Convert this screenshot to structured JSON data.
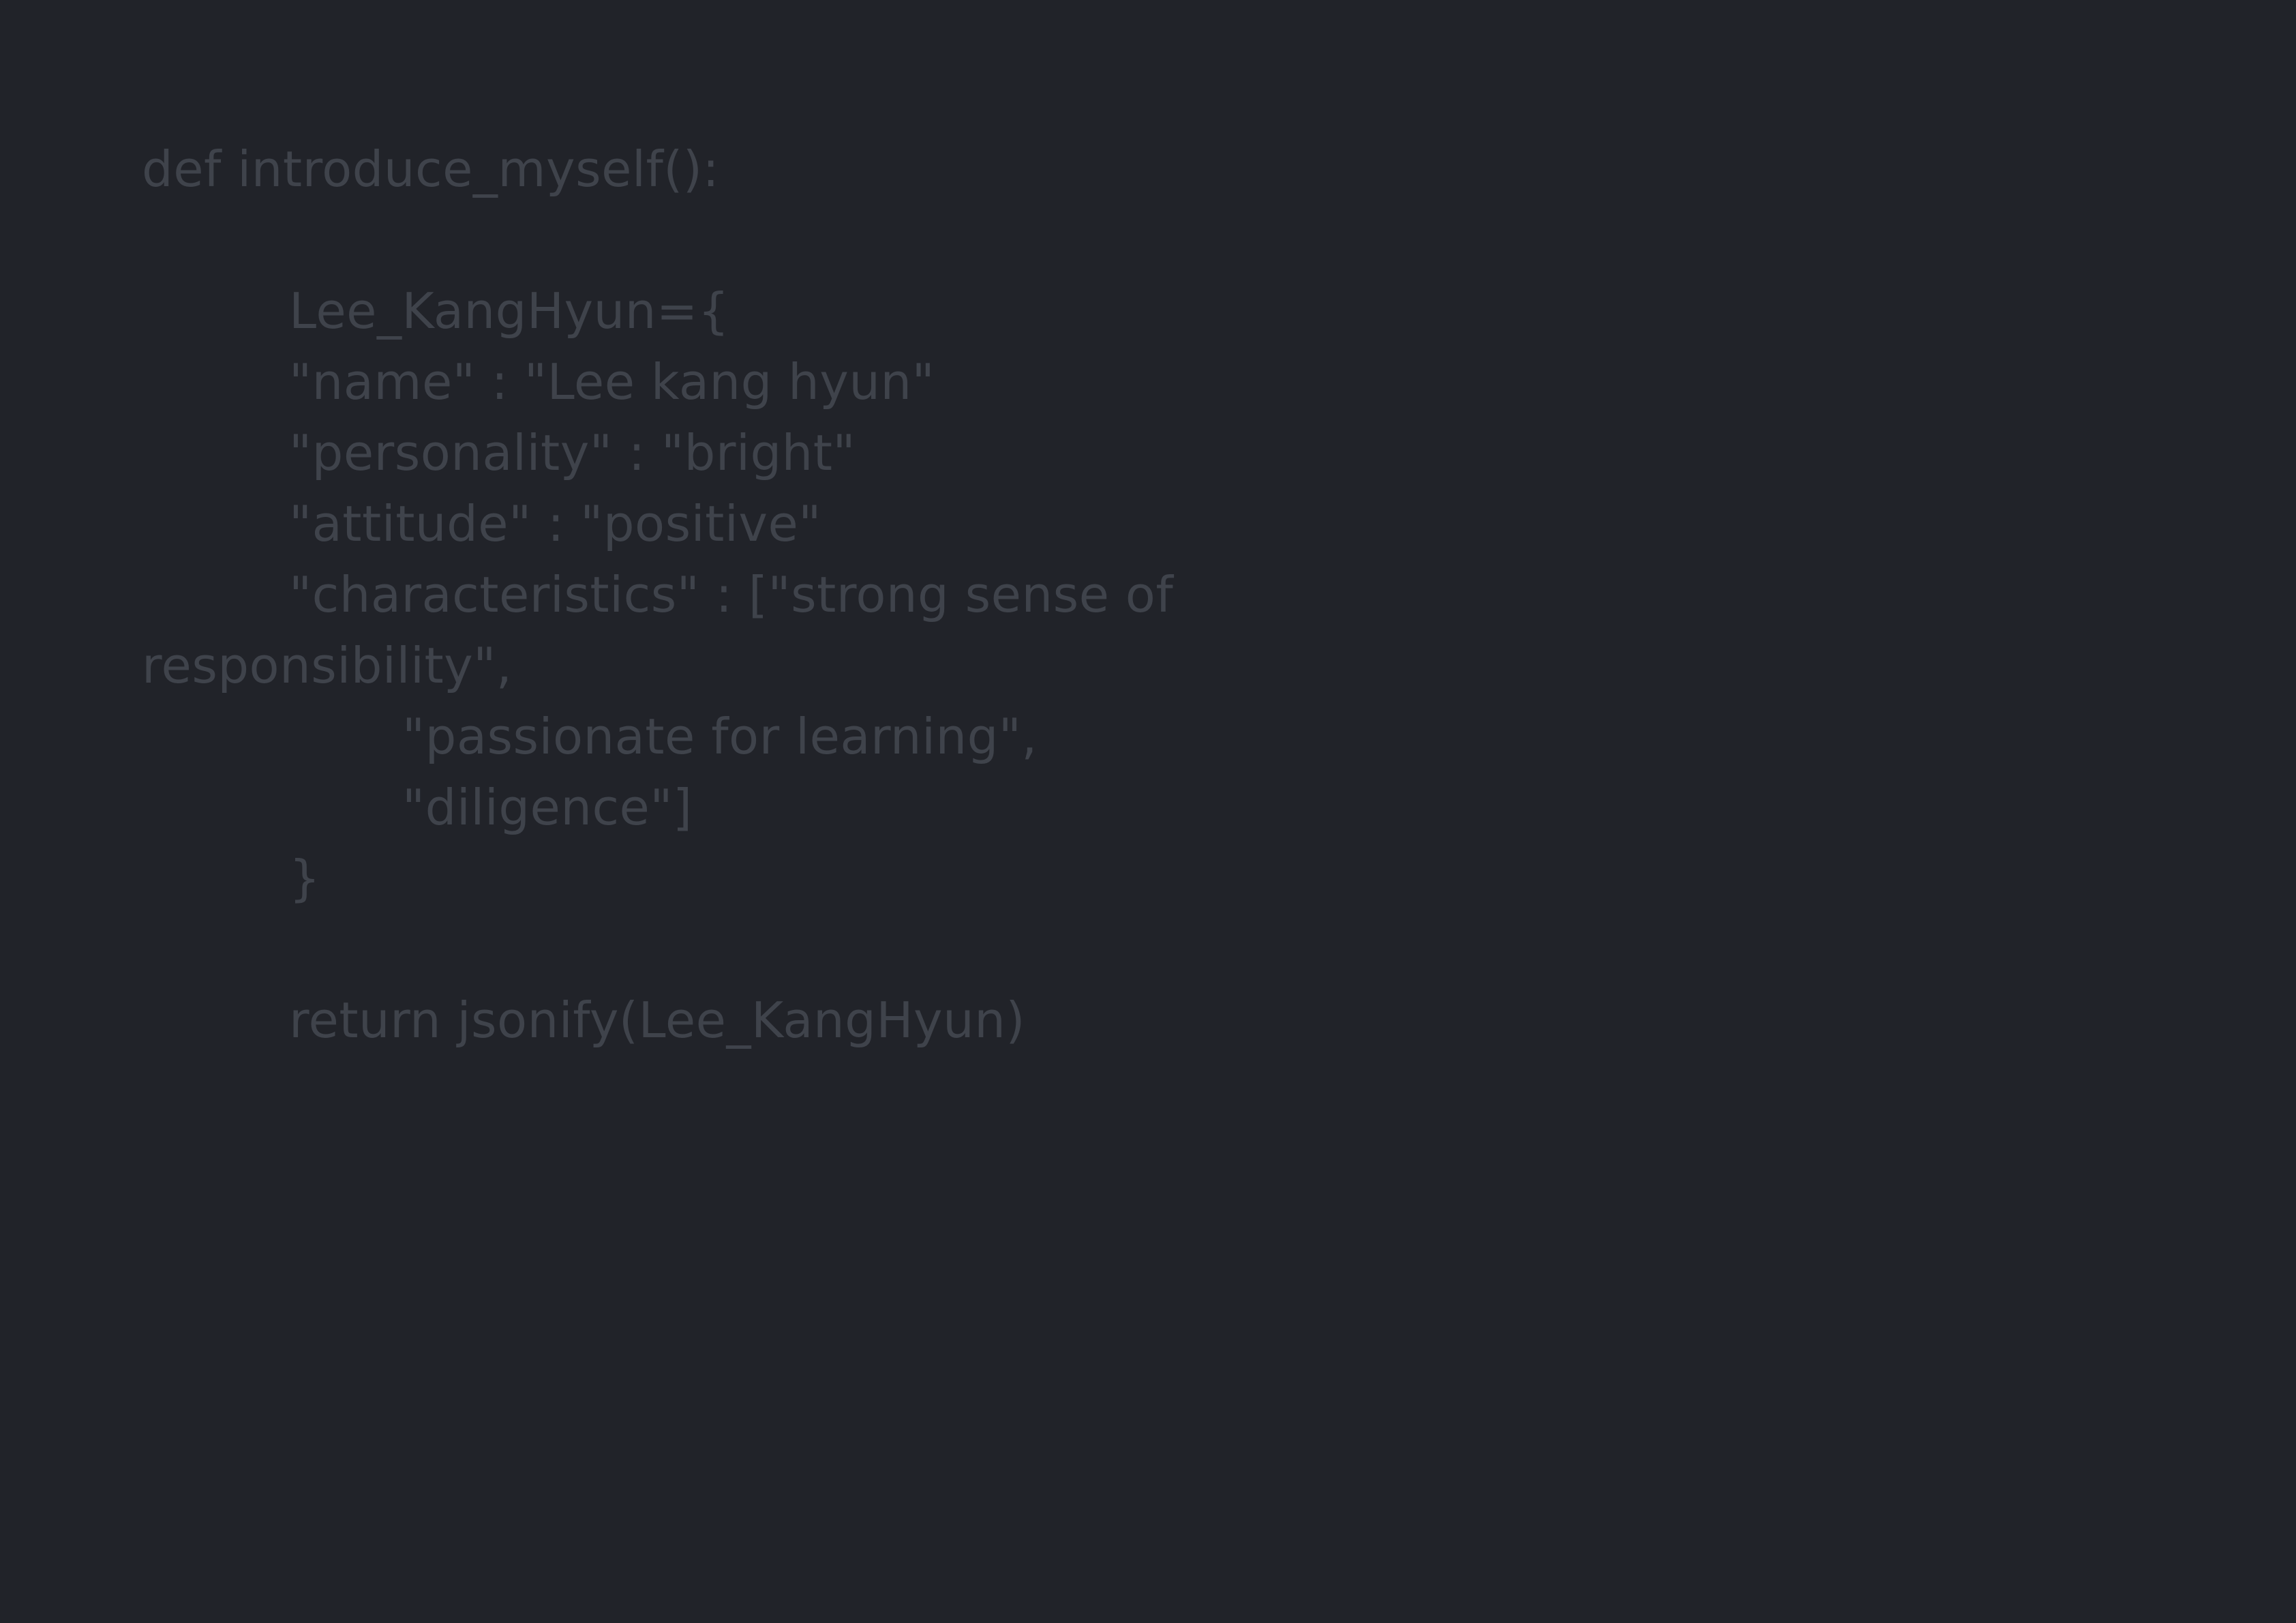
{
  "editor": {
    "background_color": "#212329",
    "text_color": "#3f434b",
    "lines": [
      "def introduce_myself():",
      "Lee_KangHyun={",
      "\"name\" : \"Lee kang hyun\"",
      "\"personality\" : \"bright\"",
      "\"attitude\" : \"positive\"",
      "\"characteristics\" : [\"strong sense of",
      "responsibility\",",
      "\"passionate for learning\",",
      "\"diligence\"]",
      "}",
      "return jsonify(Lee_KangHyun)"
    ]
  }
}
